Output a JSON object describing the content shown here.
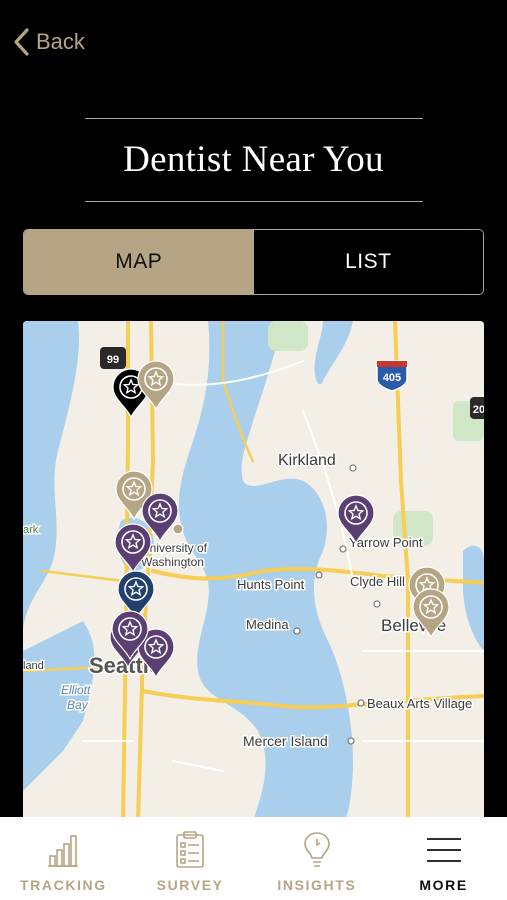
{
  "nav": {
    "back_label": "Back",
    "back_icon": "chevron-left-icon"
  },
  "header": {
    "title": "Dentist Near You"
  },
  "view_toggle": {
    "map_label": "MAP",
    "list_label": "LIST",
    "selected": "MAP"
  },
  "map": {
    "place_labels": [
      "Kirkland",
      "Yarrow Point",
      "University of",
      "Washington",
      "Hunts Point",
      "Clyde Hill",
      "Medina",
      "Bellevue",
      "Seattle",
      "Elliott",
      "Bay",
      "Beaux Arts Village",
      "Mercer Island",
      "ark",
      "land"
    ],
    "shields": [
      "99",
      "405",
      "20"
    ],
    "pins": [
      {
        "style": "black"
      },
      {
        "style": "gold"
      },
      {
        "style": "gold"
      },
      {
        "style": "purple"
      },
      {
        "style": "purple"
      },
      {
        "style": "navy"
      },
      {
        "style": "purple"
      },
      {
        "style": "purple"
      },
      {
        "style": "purple"
      },
      {
        "style": "purple"
      },
      {
        "style": "gold"
      },
      {
        "style": "gold"
      }
    ]
  },
  "tabs": [
    {
      "label": "TRACKING",
      "icon": "bar-chart-icon",
      "selected": false
    },
    {
      "label": "SURVEY",
      "icon": "clipboard-checklist-icon",
      "selected": false
    },
    {
      "label": "INSIGHTS",
      "icon": "lightbulb-icon",
      "selected": false
    },
    {
      "label": "MORE",
      "icon": "hamburger-menu-icon",
      "selected": true
    }
  ],
  "colors": {
    "accent": "#b5a584",
    "pin_purple": "#5b3f73",
    "pin_navy": "#21406e",
    "pin_gold": "#b5a584",
    "pin_black": "#000000",
    "water": "#a9cfec",
    "land": "#f3efe6",
    "road": "#f6cd55"
  }
}
